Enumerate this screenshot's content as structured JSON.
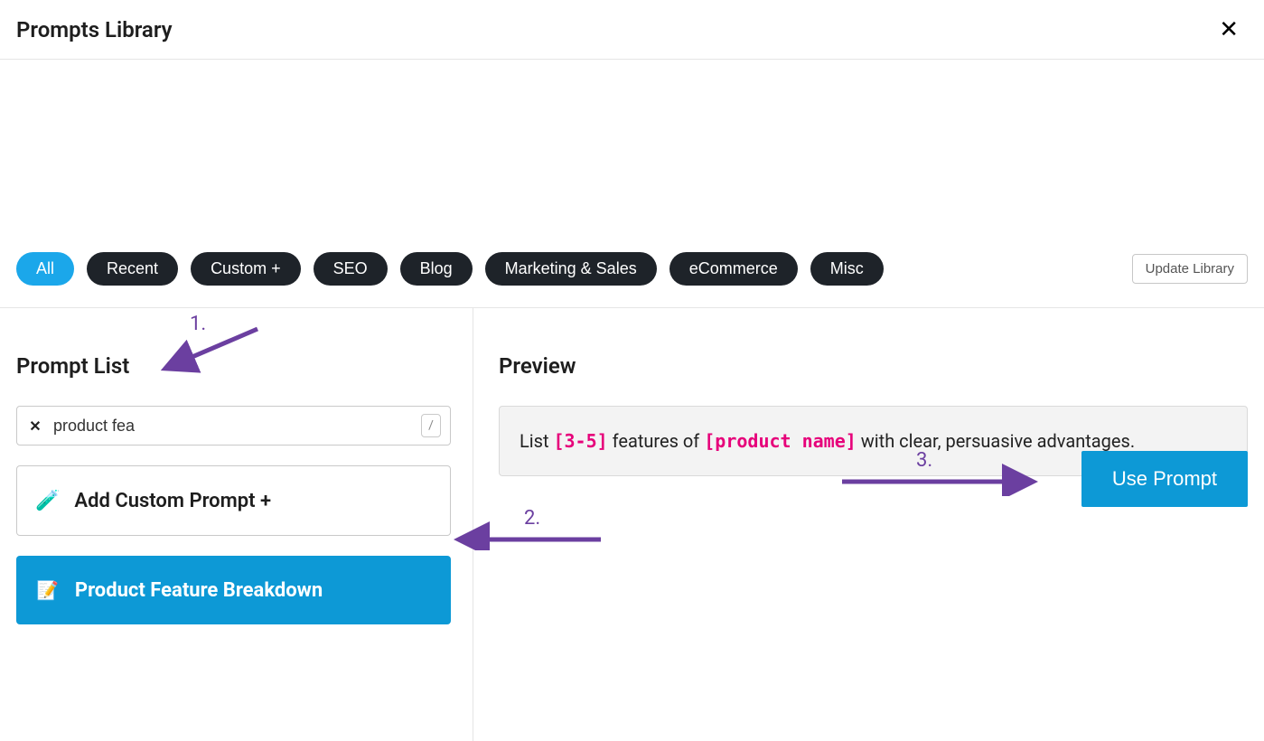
{
  "header": {
    "title": "Prompts Library"
  },
  "filters": {
    "items": [
      {
        "label": "All",
        "active": true
      },
      {
        "label": "Recent",
        "active": false
      },
      {
        "label": "Custom +",
        "active": false
      },
      {
        "label": "SEO",
        "active": false
      },
      {
        "label": "Blog",
        "active": false
      },
      {
        "label": "Marketing & Sales",
        "active": false
      },
      {
        "label": "eCommerce",
        "active": false
      },
      {
        "label": "Misc",
        "active": false
      }
    ],
    "update_label": "Update Library"
  },
  "left": {
    "title": "Prompt List",
    "search": {
      "value": "product fea",
      "shortcut": "/"
    },
    "add_custom": {
      "emoji": "🧪",
      "label": "Add Custom Prompt +"
    },
    "selected_prompt": {
      "emoji": "📝",
      "label": "Product Feature Breakdown"
    }
  },
  "right": {
    "title": "Preview",
    "preview": {
      "prefix": "List ",
      "token1": "[3-5]",
      "mid": " features of ",
      "token2": "[product name]",
      "suffix": " with clear, persuasive advantages."
    },
    "use_prompt_label": "Use Prompt"
  },
  "annotations": {
    "n1": "1.",
    "n2": "2.",
    "n3": "3."
  }
}
